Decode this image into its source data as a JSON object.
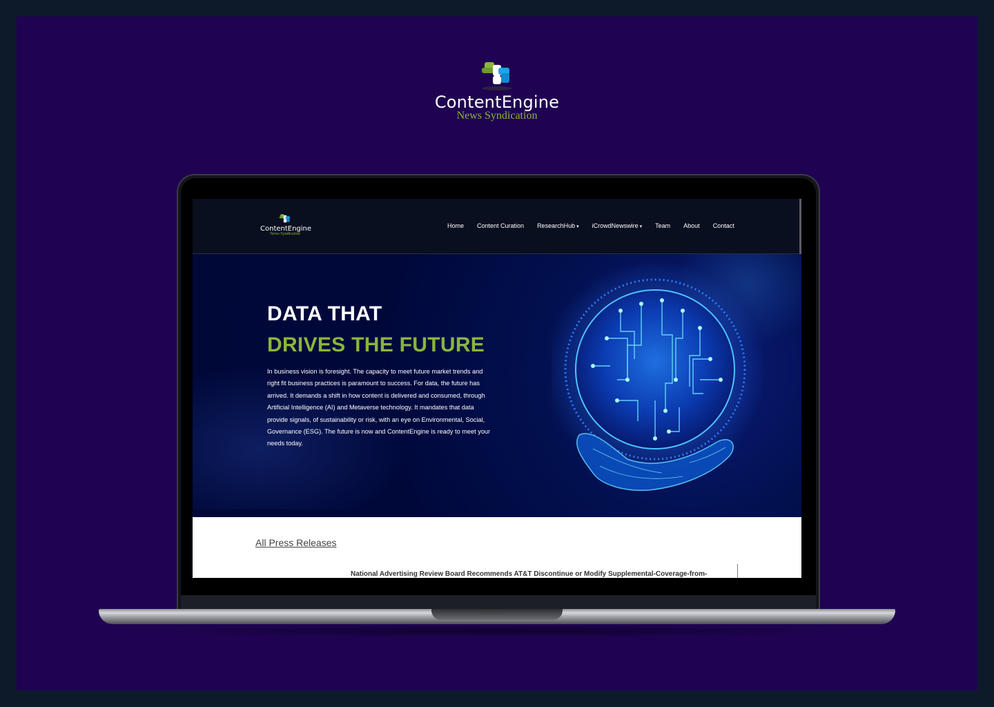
{
  "brand": {
    "name": "ContentEngine",
    "tagline": "News Syndication",
    "colors": {
      "frame": "#1f0352",
      "accent_green": "#8ab53a",
      "hero_bg": "#000838",
      "nav_bg": "#0a0f1f"
    },
    "logo_icon": "puzzle-cross-logo-icon"
  },
  "nav": {
    "items": [
      {
        "label": "Home",
        "has_dropdown": false
      },
      {
        "label": "Content Curation",
        "has_dropdown": false
      },
      {
        "label": "ResearchHub",
        "has_dropdown": true
      },
      {
        "label": "iCrowdNewswire",
        "has_dropdown": true
      },
      {
        "label": "Team",
        "has_dropdown": false
      },
      {
        "label": "About",
        "has_dropdown": false
      },
      {
        "label": "Contact",
        "has_dropdown": false
      }
    ],
    "caret": "▾"
  },
  "hero": {
    "title_line1": "DATA THAT",
    "title_line2": "DRIVES THE FUTURE",
    "description": "In business vision is foresight. The capacity to meet future market trends and right fit business practices is paramount to success. For data, the future has arrived. It demands a shift in how content is delivered and consumed, through Artificial Intelligence (AI) and Metaverse technology. It mandates that data provide signals, of sustainability or risk, with an eye on Environmental, Social, Governance (ESG). The future is now and ContentEngine is ready to meet your needs today.",
    "illustration": "circuit-globe-in-hand-icon"
  },
  "press": {
    "link_label": "All Press Releases",
    "first_item": "National Advertising Review Board Recommends AT&T Discontinue or Modify Supplemental-Coverage-from-"
  }
}
